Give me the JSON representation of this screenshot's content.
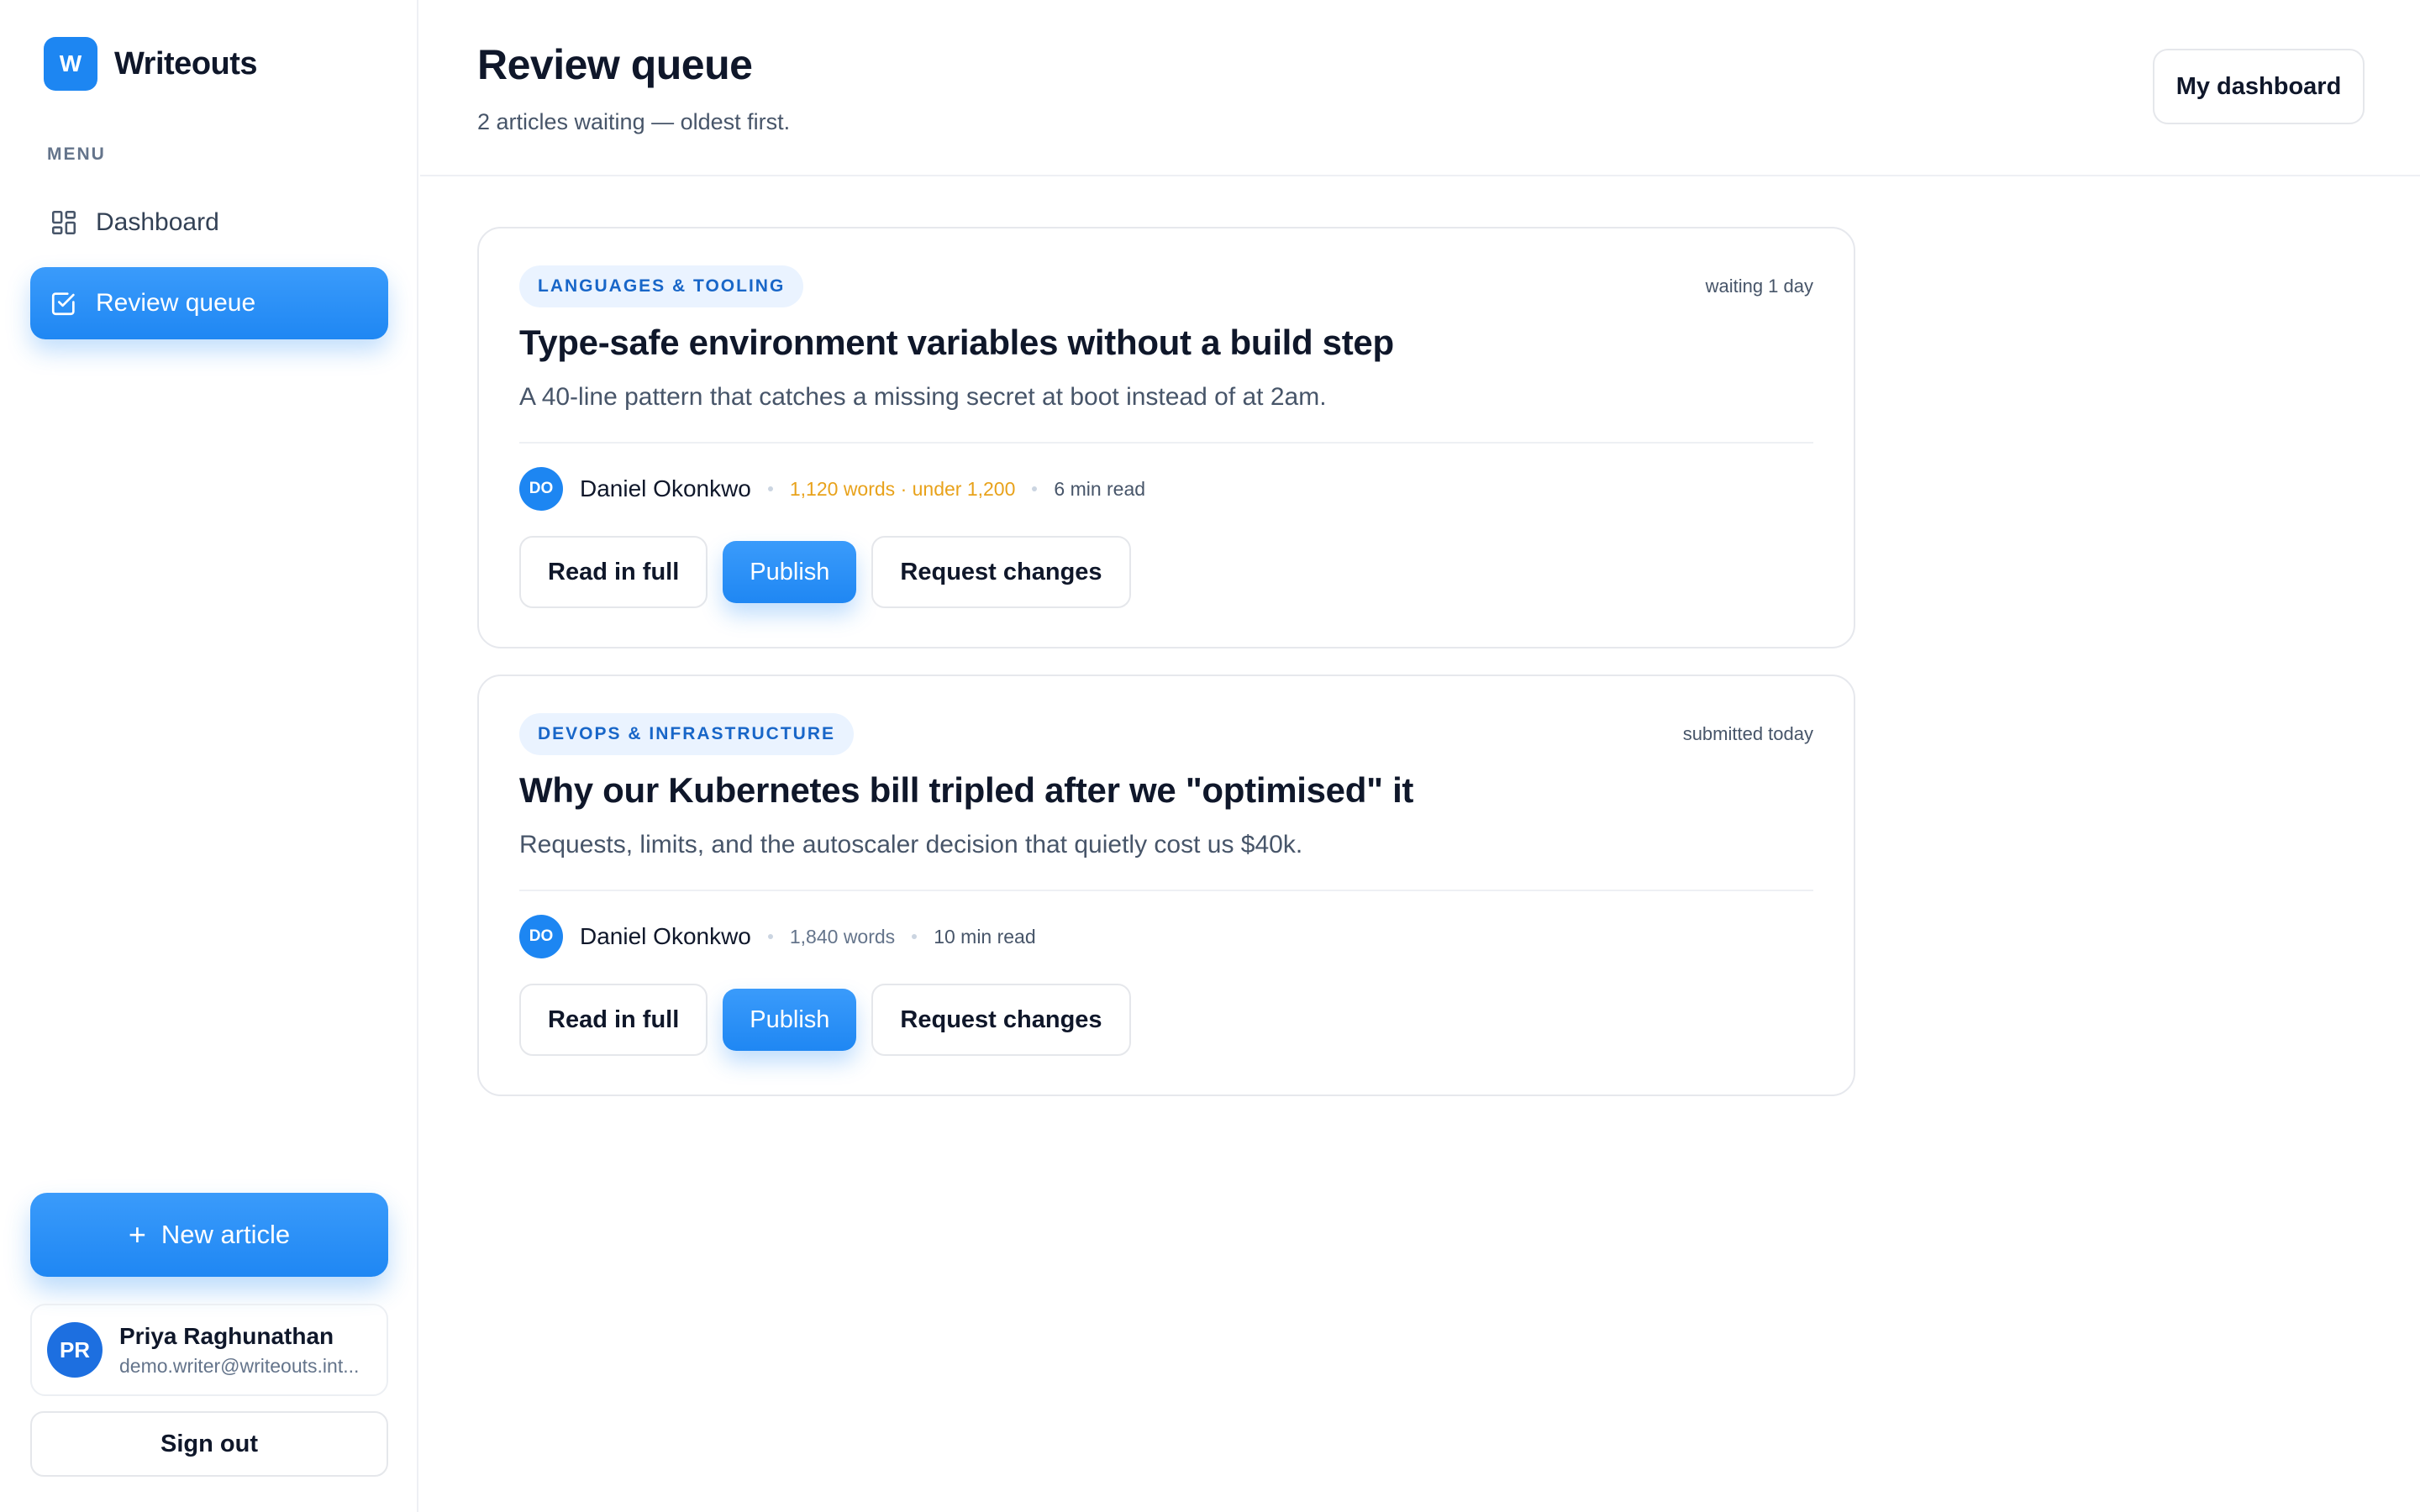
{
  "brand": {
    "logo_letter": "W",
    "name": "Writeouts",
    "color": "#1d86f2"
  },
  "sidebar": {
    "menu_label": "MENU",
    "items": [
      {
        "label": "Dashboard",
        "icon": "grid-icon",
        "active": false
      },
      {
        "label": "Review queue",
        "icon": "checkbox-icon",
        "active": true
      }
    ],
    "new_article_label": "New article",
    "user": {
      "initials": "PR",
      "name": "Priya Raghunathan",
      "email": "demo.writer@writeouts.int..."
    },
    "sign_out_label": "Sign out"
  },
  "header": {
    "title": "Review queue",
    "subtitle": "2 articles waiting — oldest first.",
    "my_dashboard_label": "My dashboard"
  },
  "articles": [
    {
      "tag": "LANGUAGES & TOOLING",
      "status": "waiting 1 day",
      "title": "Type-safe environment variables without a build step",
      "description": "A 40-line pattern that catches a missing secret at boot instead of at 2am.",
      "author_initials": "DO",
      "author": "Daniel Okonkwo",
      "words": "1,120 words · under 1,200",
      "words_warning": true,
      "read_time": "6 min read",
      "actions": {
        "read": "Read in full",
        "publish": "Publish",
        "request": "Request changes"
      }
    },
    {
      "tag": "DEVOPS & INFRASTRUCTURE",
      "status": "submitted today",
      "title": "Why our Kubernetes bill tripled after we \"optimised\" it",
      "description": "Requests, limits, and the autoscaler decision that quietly cost us $40k.",
      "author_initials": "DO",
      "author": "Daniel Okonkwo",
      "words": "1,840 words",
      "words_warning": false,
      "read_time": "10 min read",
      "actions": {
        "read": "Read in full",
        "publish": "Publish",
        "request": "Request changes"
      }
    }
  ],
  "colors": {
    "accent": "#1f87f3",
    "warning": "#e8a21b",
    "tag_bg": "#eaf3ff",
    "tag_text": "#1866c8"
  }
}
